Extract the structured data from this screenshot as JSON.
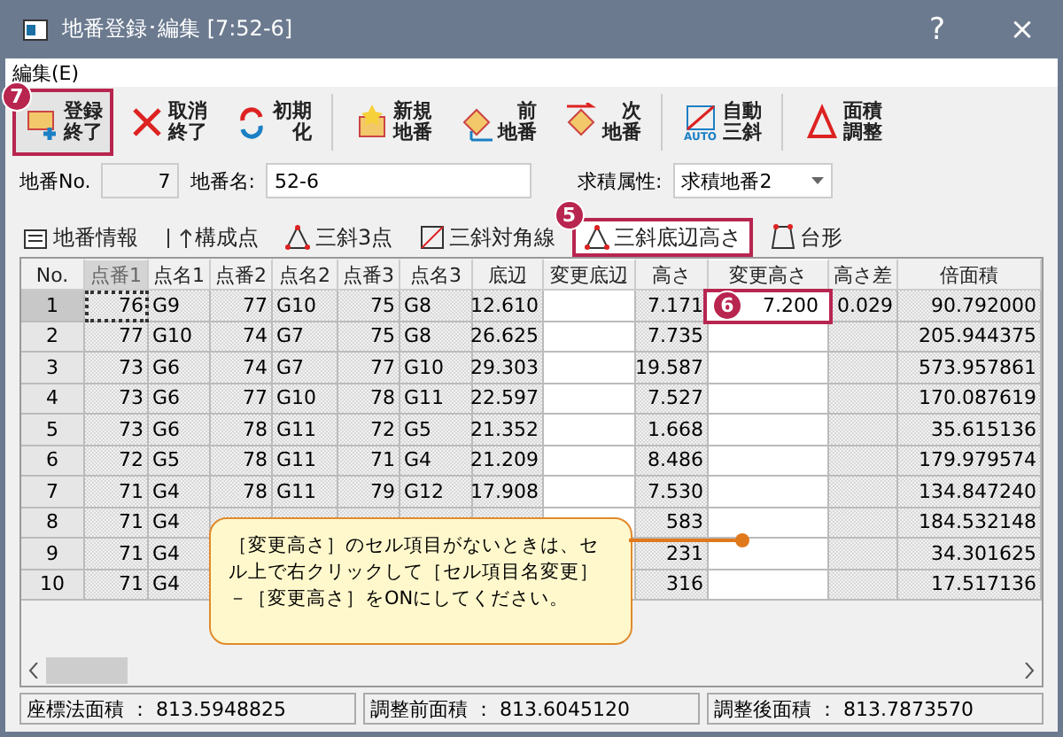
{
  "window": {
    "title": "地番登録･編集 [7:52-6]",
    "help": "?",
    "close": "×"
  },
  "menu": [
    {
      "label": "編集(E)"
    }
  ],
  "toolbar": [
    {
      "kind": "register",
      "lines": [
        "登録",
        "終了"
      ],
      "annotation": "7"
    },
    {
      "kind": "cancel",
      "lines": [
        "取消",
        "終了"
      ]
    },
    {
      "kind": "reset",
      "lines": [
        "初期",
        "化"
      ],
      "separator_after": true
    },
    {
      "kind": "new",
      "lines": [
        "新規",
        "地番"
      ]
    },
    {
      "kind": "prev",
      "lines": [
        "前",
        "地番"
      ]
    },
    {
      "kind": "next",
      "lines": [
        "次",
        "地番"
      ],
      "separator_after": true
    },
    {
      "kind": "auto",
      "lines": [
        "自動",
        "三斜"
      ],
      "icon_text": "AUTO",
      "separator_after": true
    },
    {
      "kind": "adjust",
      "lines": [
        "面積",
        "調整"
      ]
    }
  ],
  "fields": {
    "number_label": "地番No.",
    "number_value": "7",
    "name_label": "地番名:",
    "name_value": "52-6",
    "attr_label": "求積属性:",
    "attr_value": "求積地番2"
  },
  "tabs": [
    {
      "kind": "info",
      "label": "地番情報",
      "selected": false
    },
    {
      "kind": "points",
      "label": "構成点",
      "selected": false
    },
    {
      "kind": "tri3",
      "label": "三斜3点",
      "selected": false
    },
    {
      "kind": "diag",
      "label": "三斜対角線",
      "selected": false
    },
    {
      "kind": "tri3",
      "label": "三斜底辺高さ",
      "selected": true,
      "annotation": "5"
    },
    {
      "kind": "trap",
      "label": "台形",
      "selected": false
    }
  ],
  "table": {
    "columns": [
      {
        "label": "No.",
        "editable": false
      },
      {
        "label": "点番1",
        "editable": false,
        "active": true
      },
      {
        "label": "点名1",
        "editable": false
      },
      {
        "label": "点番2",
        "editable": false
      },
      {
        "label": "点名2",
        "editable": false
      },
      {
        "label": "点番3",
        "editable": false
      },
      {
        "label": "点名3",
        "editable": false
      },
      {
        "label": "底辺",
        "editable": false
      },
      {
        "label": "変更底辺",
        "editable": true
      },
      {
        "label": "高さ",
        "editable": false
      },
      {
        "label": "変更高さ",
        "editable": true
      },
      {
        "label": "高さ差",
        "editable": false
      },
      {
        "label": "倍面積",
        "editable": false
      }
    ],
    "rows": [
      {
        "selected": true,
        "cells": [
          "1",
          "76",
          "G9",
          "77",
          "G10",
          "75",
          "G8",
          "12.610",
          null,
          "7.171",
          "7.200",
          "0.029",
          "90.792000"
        ],
        "annotation": "6"
      },
      {
        "selected": false,
        "cells": [
          "2",
          "77",
          "G10",
          "74",
          "G7",
          "75",
          "G8",
          "26.625",
          null,
          "7.735",
          null,
          null,
          "205.944375"
        ]
      },
      {
        "selected": false,
        "cells": [
          "3",
          "73",
          "G6",
          "74",
          "G7",
          "77",
          "G10",
          "29.303",
          null,
          "19.587",
          null,
          null,
          "573.957861"
        ]
      },
      {
        "selected": false,
        "cells": [
          "4",
          "73",
          "G6",
          "77",
          "G10",
          "78",
          "G11",
          "22.597",
          null,
          "7.527",
          null,
          null,
          "170.087619"
        ]
      },
      {
        "selected": false,
        "cells": [
          "5",
          "73",
          "G6",
          "78",
          "G11",
          "72",
          "G5",
          "21.352",
          null,
          "1.668",
          null,
          null,
          "35.615136"
        ]
      },
      {
        "selected": false,
        "cells": [
          "6",
          "72",
          "G5",
          "78",
          "G11",
          "71",
          "G4",
          "21.209",
          null,
          "8.486",
          null,
          null,
          "179.979574"
        ]
      },
      {
        "selected": false,
        "cells": [
          "7",
          "71",
          "G4",
          "78",
          "G11",
          "79",
          "G12",
          "17.908",
          null,
          "7.530",
          null,
          null,
          "134.847240"
        ]
      },
      {
        "selected": false,
        "cells": [
          "8",
          "71",
          "G4",
          null,
          null,
          null,
          null,
          null,
          null,
          "583",
          null,
          null,
          "184.532148"
        ]
      },
      {
        "selected": false,
        "cells": [
          "9",
          "71",
          "G4",
          null,
          null,
          null,
          null,
          null,
          null,
          "231",
          null,
          null,
          "34.301625"
        ]
      },
      {
        "selected": false,
        "cells": [
          "10",
          "71",
          "G4",
          null,
          null,
          null,
          null,
          null,
          null,
          "316",
          null,
          null,
          "17.517136"
        ]
      }
    ]
  },
  "callout": {
    "text": "［変更高さ］のセル項目がないときは、セル上で右クリックして［セル項目名変更］－［変更高さ］をONにしてください。"
  },
  "status_bar": [
    {
      "label": "座標法面積 ： 813.5948825"
    },
    {
      "label": "調整前面積 ： 813.6045120"
    },
    {
      "label": "調整後面積 ： 813.7873570"
    }
  ]
}
